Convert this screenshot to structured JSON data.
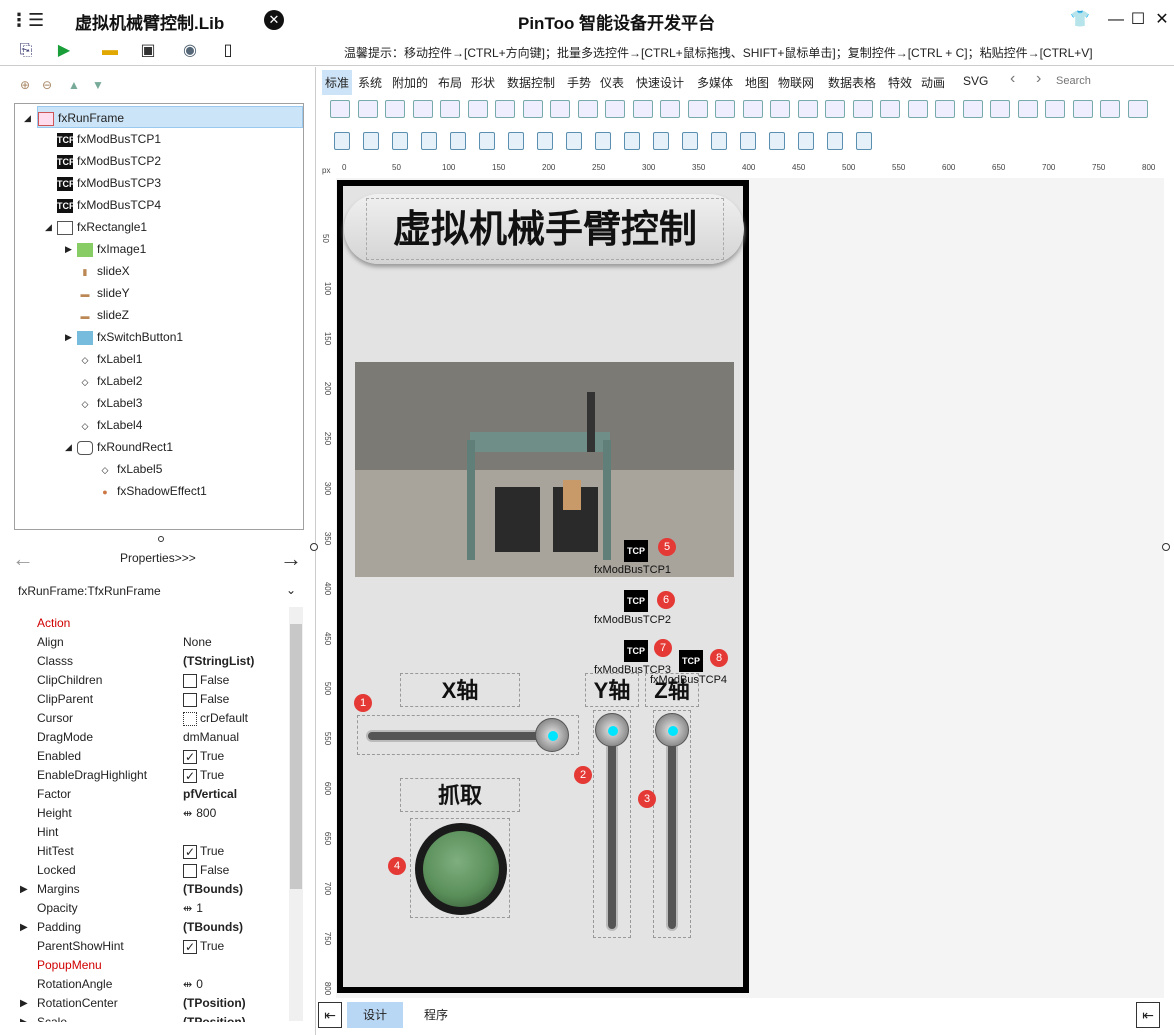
{
  "titlebar": {
    "doc_title": "虚拟机械臂控制.Lib",
    "app_title": "PinToo 智能设备开发平台"
  },
  "toolbar": {
    "tip": "温馨提示：移动控件→[CTRL+方向键]；批量多选控件→[CTRL+鼠标拖拽、SHIFT+鼠标单击]；复制控件→[CTRL + C]；粘贴控件→[CTRL+V]"
  },
  "tree": {
    "nodes": [
      {
        "label": "fxRunFrame"
      },
      {
        "label": "fxModBusTCP1"
      },
      {
        "label": "fxModBusTCP2"
      },
      {
        "label": "fxModBusTCP3"
      },
      {
        "label": "fxModBusTCP4"
      },
      {
        "label": "fxRectangle1"
      },
      {
        "label": "fxImage1"
      },
      {
        "label": "slideX"
      },
      {
        "label": "slideY"
      },
      {
        "label": "slideZ"
      },
      {
        "label": "fxSwitchButton1"
      },
      {
        "label": "fxLabel1"
      },
      {
        "label": "fxLabel2"
      },
      {
        "label": "fxLabel3"
      },
      {
        "label": "fxLabel4"
      },
      {
        "label": "fxRoundRect1"
      },
      {
        "label": "fxLabel5"
      },
      {
        "label": "fxShadowEffect1"
      }
    ]
  },
  "props_header": "Properties>>>",
  "component_selector": "fxRunFrame:TfxRunFrame",
  "properties": [
    {
      "name": "Action",
      "value": ""
    },
    {
      "name": "Align",
      "value": "None"
    },
    {
      "name": "Classs",
      "value": "(TStringList)"
    },
    {
      "name": "ClipChildren",
      "value": "False"
    },
    {
      "name": "ClipParent",
      "value": "False"
    },
    {
      "name": "Cursor",
      "value": "crDefault"
    },
    {
      "name": "DragMode",
      "value": "dmManual"
    },
    {
      "name": "Enabled",
      "value": "True"
    },
    {
      "name": "EnableDragHighlight",
      "value": "True"
    },
    {
      "name": "Factor",
      "value": "pfVertical"
    },
    {
      "name": "Height",
      "value": "800"
    },
    {
      "name": "Hint",
      "value": ""
    },
    {
      "name": "HitTest",
      "value": "True"
    },
    {
      "name": "Locked",
      "value": "False"
    },
    {
      "name": "Margins",
      "value": "(TBounds)"
    },
    {
      "name": "Opacity",
      "value": "1"
    },
    {
      "name": "Padding",
      "value": "(TBounds)"
    },
    {
      "name": "ParentShowHint",
      "value": "True"
    },
    {
      "name": "PopupMenu",
      "value": ""
    },
    {
      "name": "RotationAngle",
      "value": "0"
    },
    {
      "name": "RotationCenter",
      "value": "(TPosition)"
    },
    {
      "name": "Scale",
      "value": "(TPosition)"
    }
  ],
  "component_tabs": [
    "标准",
    "系统",
    "附加的",
    "布局",
    "形状",
    "数据控制",
    "手势",
    "仪表",
    "快速设计",
    "多媒体",
    "地图",
    "物联网",
    "数据表格",
    "特效",
    "动画",
    "SVG"
  ],
  "search_placeholder": "Search",
  "ruler_unit": "px",
  "ruler_top": [
    "0",
    "50",
    "100",
    "150",
    "200",
    "250",
    "300",
    "350",
    "400",
    "450",
    "500",
    "550",
    "600",
    "650",
    "700",
    "750",
    "800"
  ],
  "ruler_left": [
    "50",
    "100",
    "150",
    "200",
    "250",
    "300",
    "350",
    "400",
    "450",
    "500",
    "550",
    "600",
    "650",
    "700",
    "750",
    "800"
  ],
  "design": {
    "title": "虚拟机械手臂控制",
    "labels": {
      "x": "X轴",
      "y": "Y轴",
      "z": "Z轴",
      "grab": "抓取"
    },
    "tcp": [
      "fxModBusTCP1",
      "fxModBusTCP2",
      "fxModBusTCP3",
      "fxModBusTCP4"
    ],
    "tcp_icon": "TCP",
    "badges": [
      "1",
      "2",
      "3",
      "4",
      "5",
      "6",
      "7",
      "8"
    ],
    "slider_x_value": 0.95,
    "slider_y_value": 0.0,
    "slider_z_value": 0.0
  },
  "bottom_tabs": {
    "design": "设计",
    "program": "程序"
  },
  "colors": {
    "accent": "#00e5ff",
    "badge": "#e53935",
    "button_green": "#5a8f5a"
  }
}
